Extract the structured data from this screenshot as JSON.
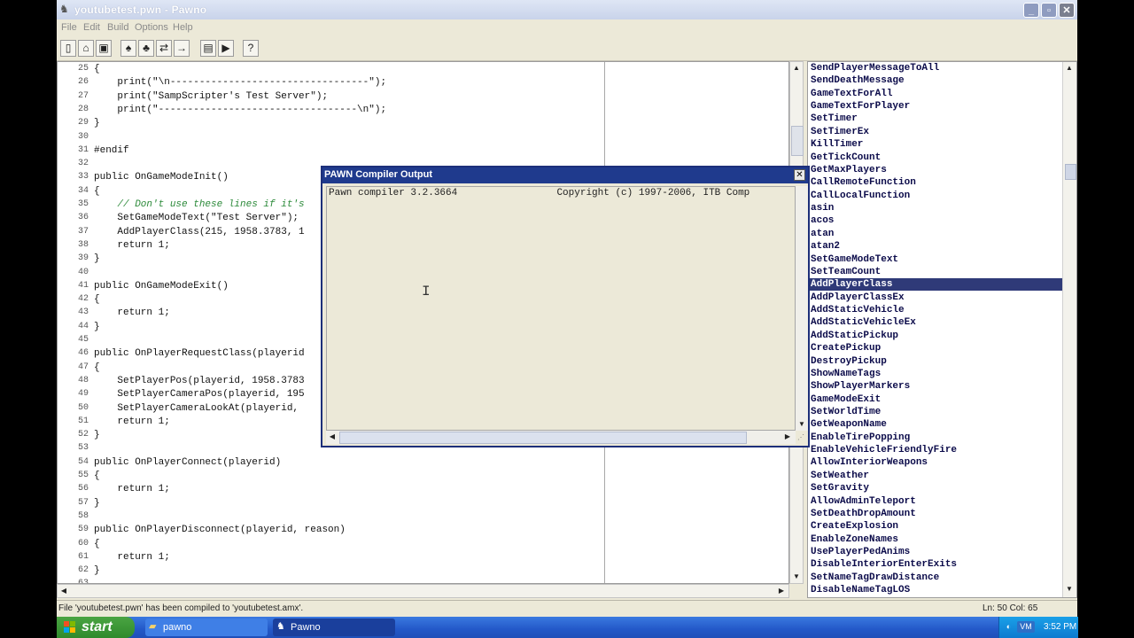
{
  "window": {
    "title": "youtubetest.pwn - Pawno",
    "minimize": "_",
    "maximize": "▫",
    "close": "✕"
  },
  "menu": [
    "File",
    "Edit",
    "Build",
    "Options",
    "Help"
  ],
  "toolbar": {
    "icons": [
      "new-icon",
      "open-icon",
      "save-icon",
      "find-icon",
      "find-next-icon",
      "replace-icon",
      "goto-icon",
      "compile-icon",
      "run-icon",
      "help-icon"
    ]
  },
  "editor": {
    "lines": [
      {
        "n": "25",
        "t": "{",
        "c": false
      },
      {
        "n": "26",
        "t": "    print(\"\\n----------------------------------\");",
        "c": false
      },
      {
        "n": "27",
        "t": "    print(\"SampScripter's Test Server\");",
        "c": false
      },
      {
        "n": "28",
        "t": "    print(\"----------------------------------\\n\");",
        "c": false
      },
      {
        "n": "29",
        "t": "}",
        "c": false
      },
      {
        "n": "30",
        "t": "",
        "c": false
      },
      {
        "n": "31",
        "t": "#endif",
        "c": false
      },
      {
        "n": "32",
        "t": "",
        "c": false
      },
      {
        "n": "33",
        "t": "public OnGameModeInit()",
        "c": false
      },
      {
        "n": "34",
        "t": "{",
        "c": false
      },
      {
        "n": "35",
        "t": "    // Don't use these lines if it's",
        "c": true
      },
      {
        "n": "36",
        "t": "    SetGameModeText(\"Test Server\");",
        "c": false
      },
      {
        "n": "37",
        "t": "    AddPlayerClass(215, 1958.3783, 1",
        "c": false
      },
      {
        "n": "38",
        "t": "    return 1;",
        "c": false
      },
      {
        "n": "39",
        "t": "}",
        "c": false
      },
      {
        "n": "40",
        "t": "",
        "c": false
      },
      {
        "n": "41",
        "t": "public OnGameModeExit()",
        "c": false
      },
      {
        "n": "42",
        "t": "{",
        "c": false
      },
      {
        "n": "43",
        "t": "    return 1;",
        "c": false
      },
      {
        "n": "44",
        "t": "}",
        "c": false
      },
      {
        "n": "45",
        "t": "",
        "c": false
      },
      {
        "n": "46",
        "t": "public OnPlayerRequestClass(playerid",
        "c": false
      },
      {
        "n": "47",
        "t": "{",
        "c": false
      },
      {
        "n": "48",
        "t": "    SetPlayerPos(playerid, 1958.3783",
        "c": false
      },
      {
        "n": "49",
        "t": "    SetPlayerCameraPos(playerid, 195",
        "c": false
      },
      {
        "n": "50",
        "t": "    SetPlayerCameraLookAt(playerid,",
        "c": false
      },
      {
        "n": "51",
        "t": "    return 1;",
        "c": false
      },
      {
        "n": "52",
        "t": "}",
        "c": false
      },
      {
        "n": "53",
        "t": "",
        "c": false
      },
      {
        "n": "54",
        "t": "public OnPlayerConnect(playerid)",
        "c": false
      },
      {
        "n": "55",
        "t": "{",
        "c": false
      },
      {
        "n": "56",
        "t": "    return 1;",
        "c": false
      },
      {
        "n": "57",
        "t": "}",
        "c": false
      },
      {
        "n": "58",
        "t": "",
        "c": false
      },
      {
        "n": "59",
        "t": "public OnPlayerDisconnect(playerid, reason)",
        "c": false
      },
      {
        "n": "60",
        "t": "{",
        "c": false
      },
      {
        "n": "61",
        "t": "    return 1;",
        "c": false
      },
      {
        "n": "62",
        "t": "}",
        "c": false
      },
      {
        "n": "63",
        "t": "",
        "c": false
      }
    ]
  },
  "functions": {
    "selected": "AddPlayerClass",
    "items": [
      "SendPlayerMessageToAll",
      "SendDeathMessage",
      "GameTextForAll",
      "GameTextForPlayer",
      "SetTimer",
      "SetTimerEx",
      "KillTimer",
      "GetTickCount",
      "GetMaxPlayers",
      "CallRemoteFunction",
      "CallLocalFunction",
      "asin",
      "acos",
      "atan",
      "atan2",
      "SetGameModeText",
      "SetTeamCount",
      "AddPlayerClass",
      "AddPlayerClassEx",
      "AddStaticVehicle",
      "AddStaticVehicleEx",
      "AddStaticPickup",
      "CreatePickup",
      "DestroyPickup",
      "ShowNameTags",
      "ShowPlayerMarkers",
      "GameModeExit",
      "SetWorldTime",
      "GetWeaponName",
      "EnableTirePopping",
      "EnableVehicleFriendlyFire",
      "AllowInteriorWeapons",
      "SetWeather",
      "SetGravity",
      "AllowAdminTeleport",
      "SetDeathDropAmount",
      "CreateExplosion",
      "EnableZoneNames",
      "UsePlayerPedAnims",
      "DisableInteriorEnterExits",
      "SetNameTagDrawDistance",
      "DisableNameTagLOS"
    ]
  },
  "compiler": {
    "title": "PAWN Compiler Output",
    "close": "✕",
    "output": "Pawn compiler 3.2.3664                 Copyright (c) 1997-2006, ITB Comp"
  },
  "status": {
    "message": "File 'youtubetest.pwn' has been compiled to 'youtubetest.amx'.",
    "position": "Ln: 50   Col: 65"
  },
  "taskbar": {
    "start": "start",
    "tasks": [
      {
        "label": "pawno",
        "icon": "folder-icon"
      },
      {
        "label": "Pawno",
        "icon": "pawno-app-icon"
      }
    ],
    "clock": "3:52 PM",
    "tray_vm": "VM"
  }
}
